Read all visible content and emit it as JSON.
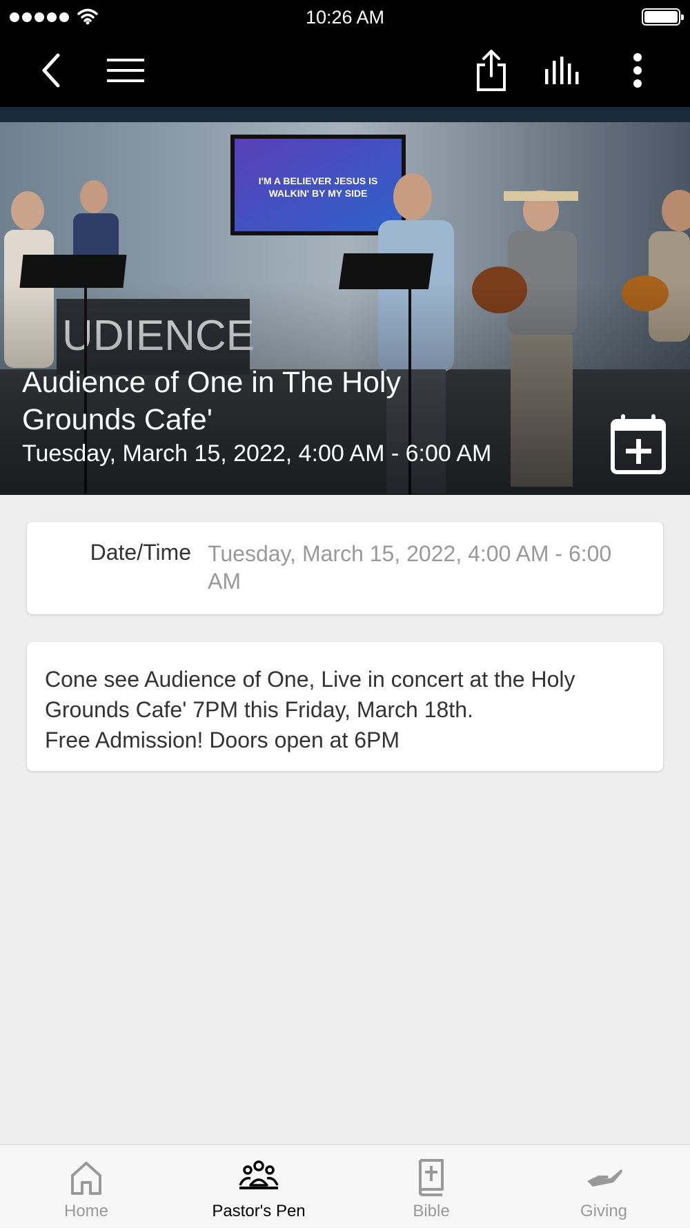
{
  "status_bar": {
    "time": "10:26 AM"
  },
  "nav": {
    "icons": [
      "back-chevron-icon",
      "hamburger-menu-icon",
      "share-icon",
      "audio-bars-icon",
      "more-vertical-icon"
    ]
  },
  "event": {
    "title": "Audience of One in The Holy Grounds Cafe'",
    "datetime": "Tuesday, March 15, 2022, 4:00 AM - 6:00 AM",
    "hero_image_text": "I'M A BELIEVER JESUS IS WALKIN' BY MY SIDE"
  },
  "details": {
    "label": "Date/Time",
    "value": "Tuesday, March 15, 2022, 4:00 AM - 6:00 AM"
  },
  "description": {
    "lines": [
      "Cone see Audience of One, Live in concert at the Holy",
      "Grounds Cafe' 7PM this Friday, March 18th.",
      "Free Admission! Doors open at 6PM"
    ]
  },
  "tabs": [
    {
      "label": "Home",
      "icon": "home-icon",
      "active": false
    },
    {
      "label": "Pastor's Pen",
      "icon": "group-icon",
      "active": true
    },
    {
      "label": "Bible",
      "icon": "bible-icon",
      "active": false
    },
    {
      "label": "Giving",
      "icon": "giving-hand-icon",
      "active": false
    }
  ],
  "colors": {
    "bar_bg": "#000000",
    "page_bg": "#eeeeee",
    "muted_text": "#999999",
    "active_tab": "#000000"
  }
}
